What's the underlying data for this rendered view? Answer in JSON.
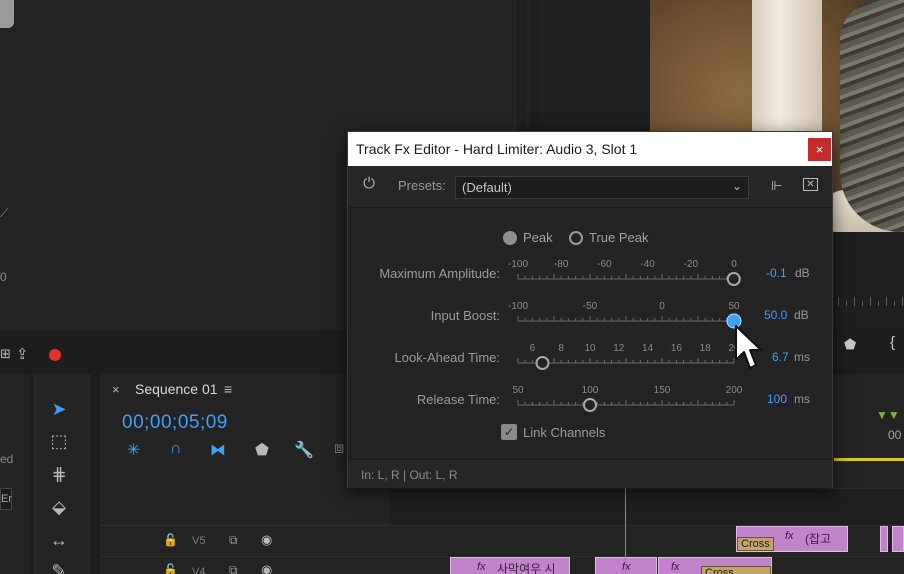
{
  "dialog": {
    "title": "Track Fx Editor - Hard Limiter: Audio 3, Slot 1",
    "close_label": "×",
    "presets_label": "Presets:",
    "preset_value": "(Default)",
    "radio_peak": "Peak",
    "radio_true_peak": "True Peak",
    "radio_selected": "Peak",
    "link_channels": "Link Channels",
    "link_channels_checked": true,
    "io_text": "In: L, R | Out: L, R",
    "params": [
      {
        "label": "Maximum Amplitude:",
        "ticks": [
          "-100",
          "-80",
          "-60",
          "-40",
          "-20",
          "0"
        ],
        "min": -100,
        "max": 0,
        "value": -0.1,
        "value_text": "-0.1",
        "unit": "dB",
        "active": false
      },
      {
        "label": "Input Boost:",
        "ticks": [
          "-100",
          "-50",
          "0",
          "50"
        ],
        "min": -100,
        "max": 50,
        "value": 50.0,
        "value_text": "50.0",
        "unit": "dB",
        "active": true
      },
      {
        "label": "Look-Ahead Time:",
        "ticks": [
          "6",
          "8",
          "10",
          "12",
          "14",
          "16",
          "18",
          "20"
        ],
        "min": 5,
        "max": 20,
        "value": 6.7,
        "value_text": "6.7",
        "unit": "ms",
        "active": false
      },
      {
        "label": "Release Time:",
        "ticks": [
          "50",
          "100",
          "150",
          "200"
        ],
        "min": 50,
        "max": 200,
        "value": 100,
        "value_text": "100",
        "unit": "ms",
        "active": false
      }
    ]
  },
  "timeline": {
    "tab_close": "×",
    "tab_label": "Sequence 01",
    "menu_icon": "≡",
    "timecode": "00;00;05;09",
    "right_time": "00",
    "tracks": [
      {
        "lock": "🔓",
        "name": "V5",
        "film": "⧉",
        "eye": "◉"
      },
      {
        "lock": "🔓",
        "name": "V4",
        "film": "⧉",
        "eye": "◉"
      }
    ],
    "clips": {
      "v5_cross": "Cross",
      "v5_fx": "fx",
      "v5_text": "(잡고",
      "v4_fx1": "fx",
      "v4_text1": "사막여우 시",
      "v4_fx2": "fx",
      "v4_fx3": "fx",
      "v4_cross": "Cross Dissolv"
    }
  },
  "edges": {
    "left_ed": "ed",
    "left_er": "Er",
    "left_zero": "0"
  },
  "colors": {
    "accent": "#3fa0f7",
    "record": "#e03030",
    "clip": "#c183c9",
    "close": "#c42b2b"
  }
}
